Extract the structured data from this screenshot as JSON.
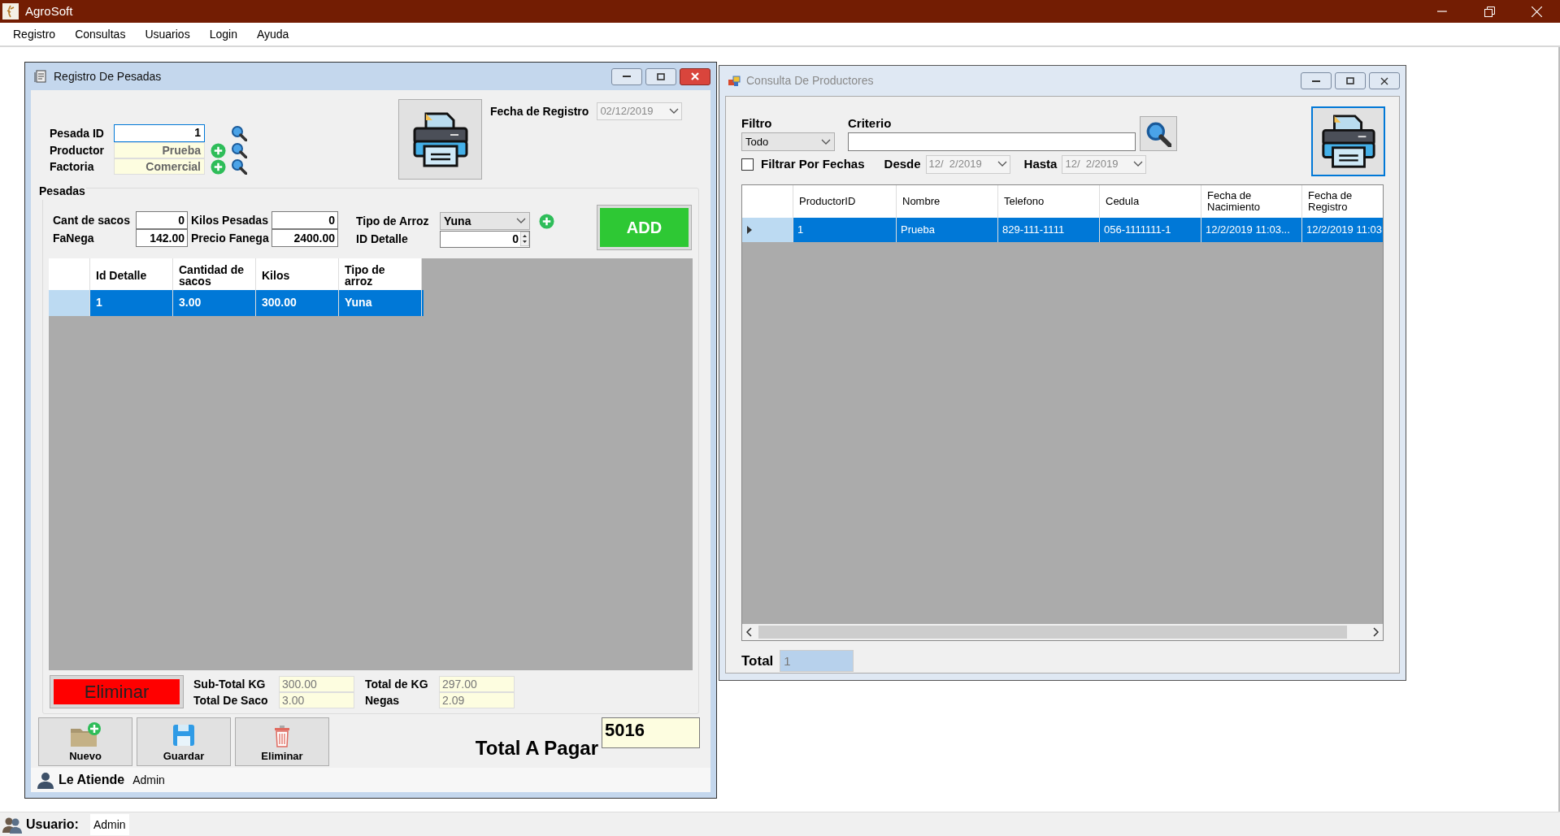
{
  "app": {
    "title": "AgroSoft"
  },
  "menu": [
    "Registro",
    "Consultas",
    "Usuarios",
    "Login",
    "Ayuda"
  ],
  "registro": {
    "title": "Registro De Pesadas",
    "fields": [
      {
        "label": "Pesada ID",
        "value": "1",
        "readonly": false,
        "add_button": false
      },
      {
        "label": "Productor",
        "value": "Prueba",
        "readonly": true,
        "add_button": true
      },
      {
        "label": "Factoria",
        "value": "Comercial",
        "readonly": true,
        "add_button": true
      }
    ],
    "fecha": {
      "label": "Fecha de Registro",
      "value": "02/12/2019"
    },
    "group_label": "Pesadas",
    "inputs": [
      {
        "label": "Cant de sacos",
        "value": "0"
      },
      {
        "label": "FaNega",
        "value": "142.00"
      },
      {
        "label": "Kilos Pesadas",
        "value": "0"
      },
      {
        "label": "Precio Fanega",
        "value": "2400.00"
      }
    ],
    "tipo": {
      "label": "Tipo de Arroz",
      "value": "Yuna"
    },
    "id_detalle": {
      "label": "ID Detalle",
      "value": "0"
    },
    "add_button": "ADD",
    "grid": {
      "columns": [
        "Id Detalle",
        "Cantidad de sacos",
        "Kilos",
        "Tipo de arroz"
      ],
      "rows": [
        {
          "cells": [
            "1",
            "3.00",
            "300.00",
            "Yuna"
          ],
          "selected": true
        }
      ]
    },
    "delete_button": "Eliminar",
    "totals": [
      {
        "label": "Sub-Total KG",
        "value": "300.00"
      },
      {
        "label": "Total De Saco",
        "value": "3.00"
      },
      {
        "label": "Total de KG",
        "value": "297.00"
      },
      {
        "label": "Negas",
        "value": "2.09"
      }
    ],
    "toolbar": [
      {
        "kind": "new",
        "label": "Nuevo"
      },
      {
        "kind": "save",
        "label": "Guardar"
      },
      {
        "kind": "delete",
        "label": "Eliminar"
      }
    ],
    "total_pagar": {
      "label": "Total A Pagar",
      "value": "5016"
    },
    "atiende": {
      "label": "Le Atiende",
      "value": "Admin"
    }
  },
  "consulta": {
    "title": "Consulta De Productores",
    "filtro": {
      "label": "Filtro",
      "value": "Todo"
    },
    "criterio": {
      "label": "Criterio"
    },
    "filtrar_fechas": {
      "label": "Filtrar Por Fechas",
      "checked": false
    },
    "desde": {
      "label": "Desde",
      "value": "12/  2/2019"
    },
    "hasta": {
      "label": "Hasta",
      "value": "12/  2/2019"
    },
    "grid": {
      "columns": [
        "ProductorID",
        "Nombre",
        "Telefono",
        "Cedula",
        "Fecha de Nacimiento",
        "Fecha de Registro"
      ],
      "rows": [
        {
          "cells": [
            "1",
            "Prueba",
            "829-111-1111",
            "056-1111111-1",
            "12/2/2019 11:03...",
            "12/2/2019 11:03"
          ],
          "selected": true
        }
      ]
    },
    "total": {
      "label": "Total",
      "value": "1"
    }
  },
  "status_bar": {
    "label": "Usuario:",
    "value": "Admin"
  }
}
